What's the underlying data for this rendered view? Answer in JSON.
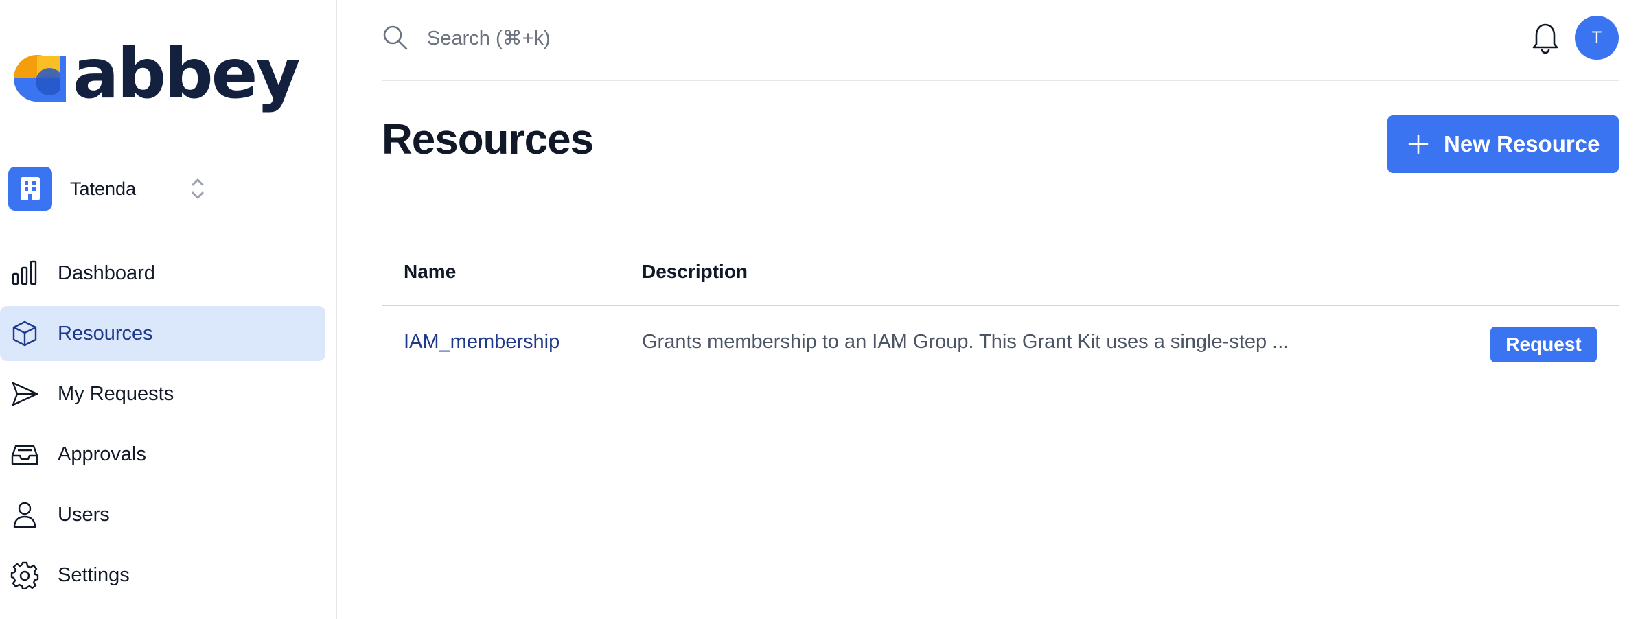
{
  "brand": {
    "logo_text": "abbey"
  },
  "org": {
    "name": "Tatenda"
  },
  "sidebar": {
    "items": [
      {
        "label": "Dashboard",
        "icon": "bar-chart-icon",
        "active": false
      },
      {
        "label": "Resources",
        "icon": "cube-icon",
        "active": true
      },
      {
        "label": "My Requests",
        "icon": "paper-plane-icon",
        "active": false
      },
      {
        "label": "Approvals",
        "icon": "inbox-tray-icon",
        "active": false
      },
      {
        "label": "Users",
        "icon": "user-icon",
        "active": false
      },
      {
        "label": "Settings",
        "icon": "gear-icon",
        "active": false
      }
    ]
  },
  "topbar": {
    "search_placeholder": "Search (⌘+k)",
    "avatar_initial": "T"
  },
  "page": {
    "title": "Resources",
    "new_button_label": "New Resource"
  },
  "table": {
    "columns": [
      "Name",
      "Description"
    ],
    "rows": [
      {
        "name": "IAM_membership",
        "description": "Grants membership to an IAM Group. This Grant Kit uses a single-step ...",
        "action_label": "Request"
      }
    ]
  },
  "colors": {
    "accent": "#3b74f0",
    "active_bg": "#dbe7fb",
    "link": "#1e3a8a"
  }
}
